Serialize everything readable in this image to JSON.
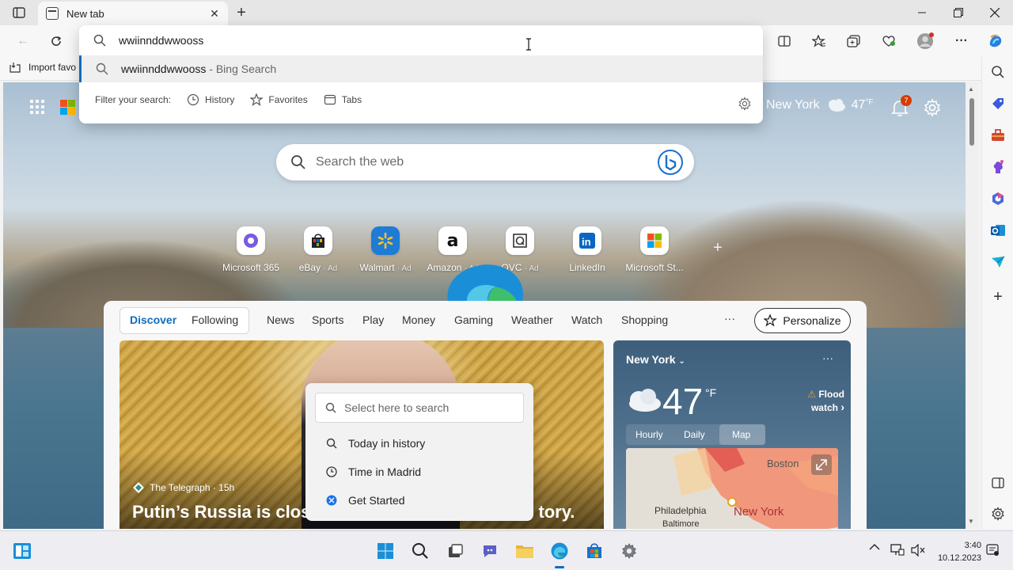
{
  "tab": {
    "title": "New tab"
  },
  "favbar": {
    "import_label": "Import favo"
  },
  "omnibox": {
    "query": "wwiinnddwwooss",
    "suggestion": "wwiinnddwwooss",
    "suggestion_sub": "- Bing Search",
    "filter_label": "Filter your search:",
    "filters": [
      "History",
      "Favorites",
      "Tabs"
    ]
  },
  "header": {
    "city": "New York",
    "temp": "47",
    "unit": "°F",
    "notifications": "7"
  },
  "search": {
    "placeholder": "Search the web"
  },
  "quicklinks": [
    {
      "label": "Microsoft 365",
      "ad": ""
    },
    {
      "label": "eBay",
      "ad": "· Ad"
    },
    {
      "label": "Walmart",
      "ad": "· Ad"
    },
    {
      "label": "Amazon",
      "ad": "· Ad"
    },
    {
      "label": "QVC",
      "ad": "· Ad"
    },
    {
      "label": "LinkedIn",
      "ad": ""
    },
    {
      "label": "Microsoft St...",
      "ad": ""
    }
  ],
  "feed": {
    "tabs": [
      "Discover",
      "Following"
    ],
    "nav": [
      "News",
      "Sports",
      "Play",
      "Money",
      "Gaming",
      "Weather",
      "Watch",
      "Shopping"
    ],
    "more": "···",
    "personalize": "Personalize",
    "hero": {
      "source": "The Telegraph · 15h",
      "title": "Putin’s Russia is clos",
      "title_end": "tory."
    }
  },
  "weather_card": {
    "city": "New York",
    "temp": "47",
    "unit": "°F",
    "alert_line1": "Flood",
    "alert_line2": "watch",
    "tabs": [
      "Hourly",
      "Daily",
      "Map"
    ],
    "map_labels": [
      "Boston",
      "Philadelphia",
      "New York",
      "Baltimore"
    ]
  },
  "context_menu": {
    "placeholder": "Select here to search",
    "items": [
      "Today in history",
      "Time in Madrid",
      "Get Started"
    ]
  },
  "taskbar": {
    "time": "3:40",
    "date": "10.12.2023"
  },
  "colors": {
    "accent": "#0f6cbd",
    "badge": "#d83b01"
  }
}
